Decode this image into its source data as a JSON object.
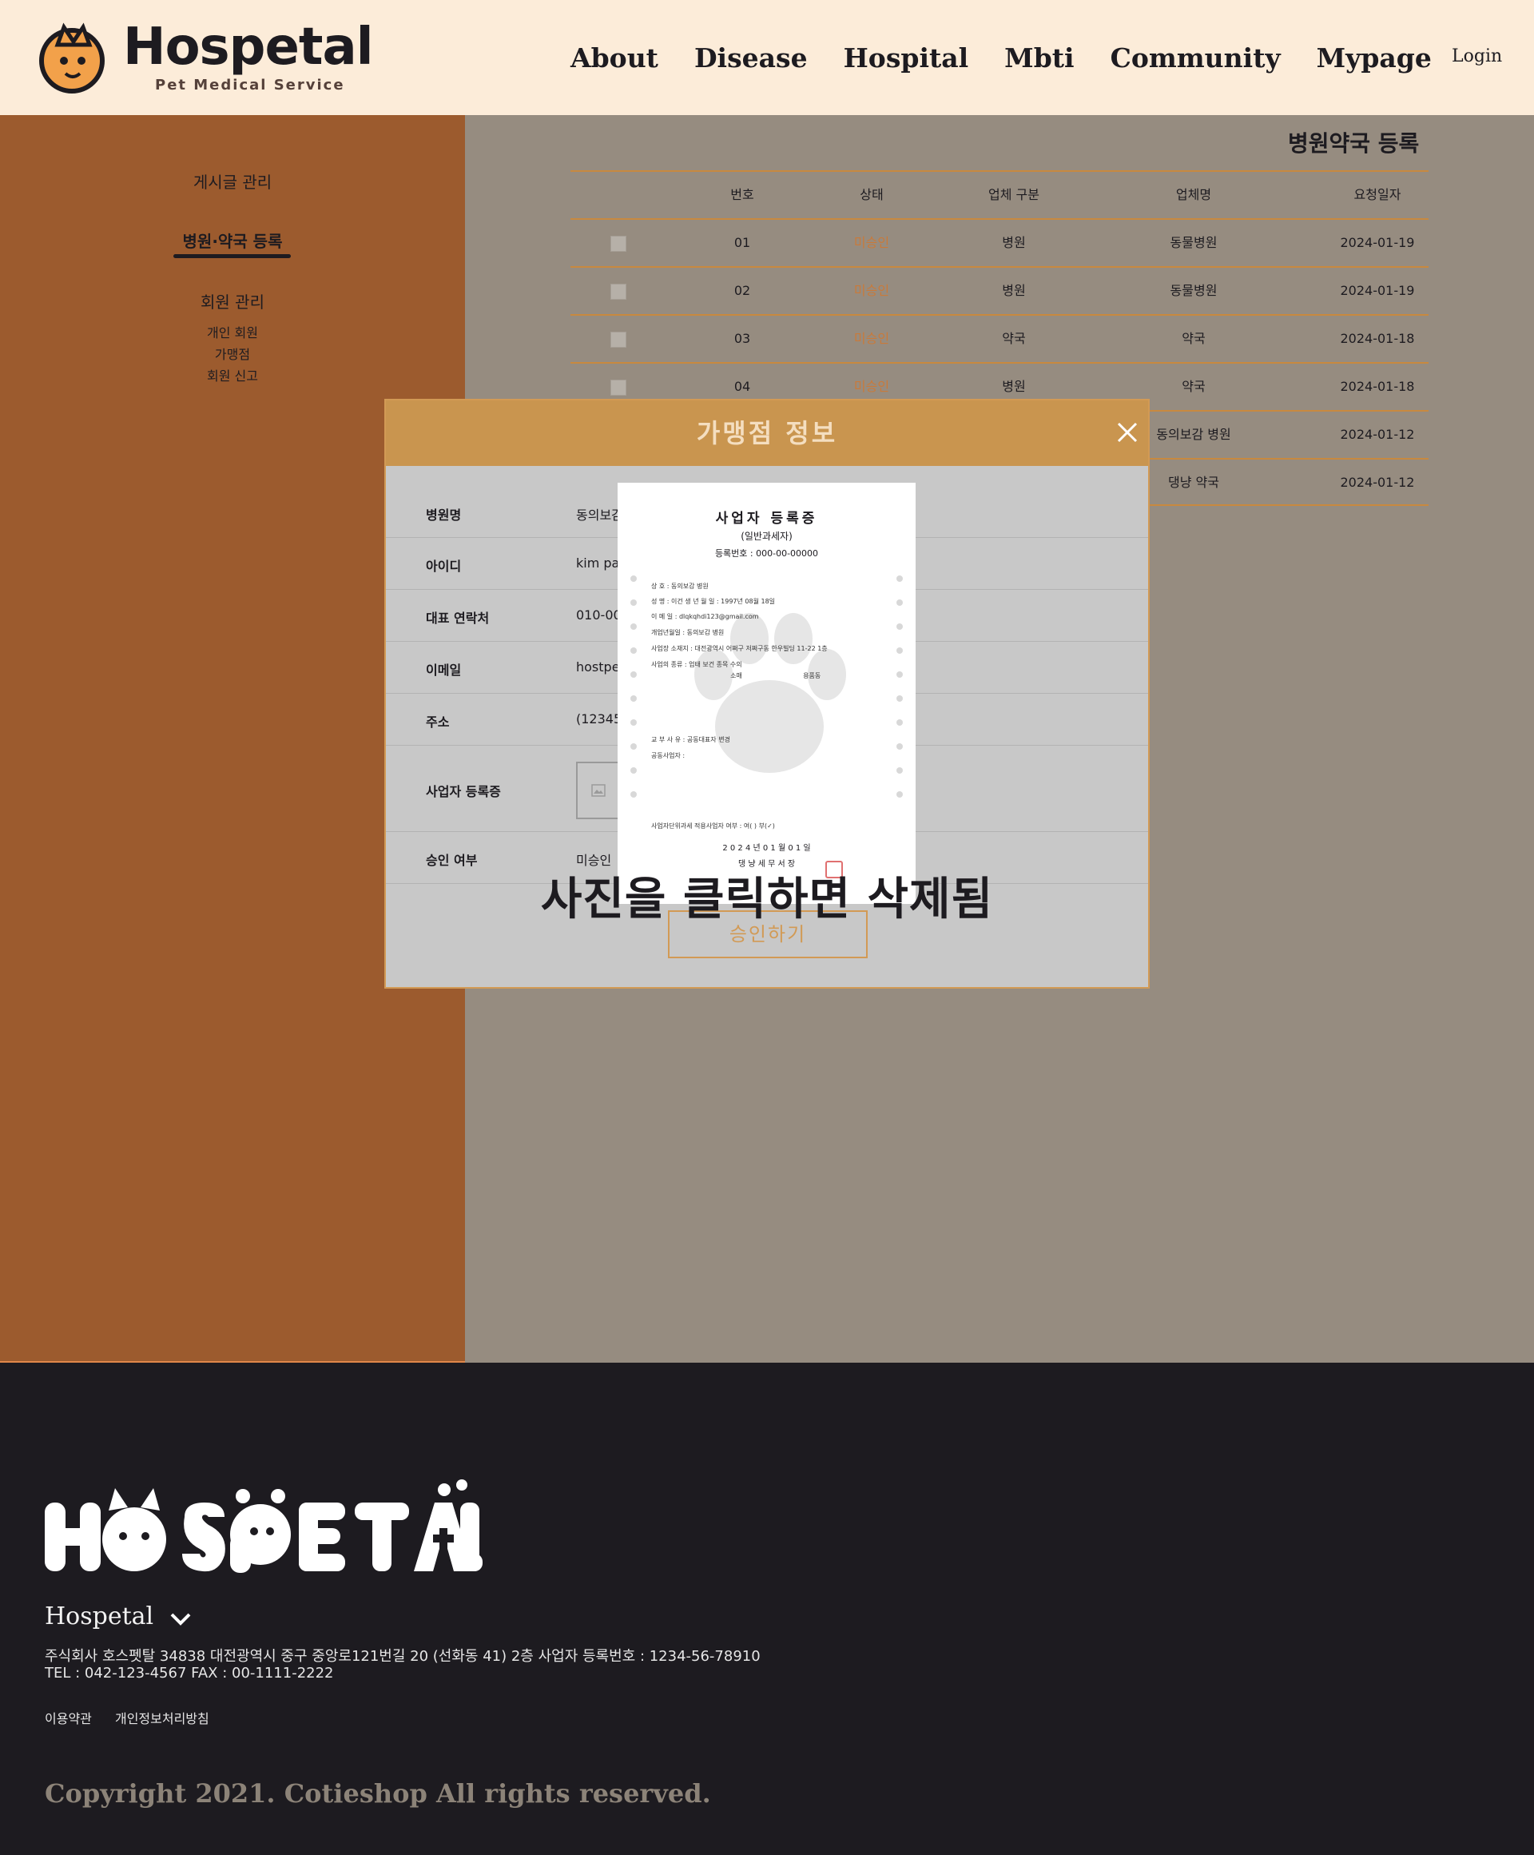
{
  "header": {
    "logo_word": "Hospetal",
    "logo_sub": "Pet Medical Service",
    "nav": [
      "About",
      "Disease",
      "Hospital",
      "Mbti",
      "Community",
      "Mypage"
    ],
    "login": "Login"
  },
  "sidebar": {
    "post_manage": "게시글 관리",
    "hospital_register": "병원·약국 등록",
    "member_manage": "회원 관리",
    "sub_items": [
      "개인 회원",
      "가맹점",
      "회원 신고"
    ]
  },
  "main": {
    "title": "병원약국 등록",
    "columns": [
      "번호",
      "상태",
      "업체 구분",
      "업체명",
      "요청일자"
    ],
    "rows": [
      {
        "no": "01",
        "status": "미승인",
        "type": "병원",
        "name": "동물병원",
        "date": "2024-01-19"
      },
      {
        "no": "02",
        "status": "미승인",
        "type": "병원",
        "name": "동물병원",
        "date": "2024-01-19"
      },
      {
        "no": "03",
        "status": "미승인",
        "type": "약국",
        "name": "약국",
        "date": "2024-01-18"
      },
      {
        "no": "04",
        "status": "미승인",
        "type": "병원",
        "name": "약국",
        "date": "2024-01-18"
      },
      {
        "no": "",
        "status": "",
        "type": "",
        "name": "동의보감 병원",
        "date": "2024-01-12"
      },
      {
        "no": "",
        "status": "",
        "type": "",
        "name": "댕냥 약국",
        "date": "2024-01-12"
      }
    ]
  },
  "modal": {
    "title": "가맹점 정보",
    "fields": [
      {
        "label": "병원명",
        "value": "동의보감"
      },
      {
        "label": "아이디",
        "value": "kim par"
      },
      {
        "label": "대표 연락처",
        "value": "010-000"
      },
      {
        "label": "이메일",
        "value": "hostpe"
      },
      {
        "label": "주소",
        "value": "(12345)"
      },
      {
        "label": "사업자 등록증",
        "value": ""
      },
      {
        "label": "승인 여부",
        "value": "미승인"
      }
    ],
    "approve_label": "승인하기"
  },
  "certificate": {
    "title": "사업자 등록증",
    "subtitle": "(일반과세자)",
    "reg_no": "등록번호 : 000-00-00000",
    "lines": [
      "상      호       :        동의보감 병원",
      "성      명       :        이건                  생 년 월 일  :       1997년 08월 18일",
      "이 메 일        :        dlqkqhdi123@gmail.com",
      "개업년월일    :        동의보감 병원",
      "사업장 소재지 :       대전광역시 어쩌구 저쩌구동 한우빌딩 11-22 1층",
      "사업의 종류  :        업태    보건                  종목     수의",
      "                                       소매                              용품동",
      "교 부 사 유  :     공동대표자 변경",
      "공동사업자 :",
      "사업자단위과세 적용사업자 여부 :   여(    ) 부(✓)",
      "2 0 2 4 년    0 1 월    0 1 일",
      "댕 냥    세 무 서 장"
    ]
  },
  "notice": "사진을 클릭하면 삭제됨",
  "footer": {
    "brand": "Hospetal",
    "info_line1": "주식회사 호스펫탈 34838 대전광역시 중구 중앙로121번길 20 (선화동 41) 2층  사업자 등록번호 : 1234-56-78910",
    "info_line2": "TEL : 042-123-4567 FAX : 00-1111-2222",
    "links": [
      "이용약관",
      "개인정보처리방침"
    ],
    "copyright": "Copyright 2021. Cotieshop All rights reserved."
  },
  "colors": {
    "header_bg": "#fcecd9",
    "sidebar_bg": "#9c5b2e",
    "main_bg": "#968c80",
    "accent": "#c9954f",
    "footer_bg": "#1d1b20"
  }
}
